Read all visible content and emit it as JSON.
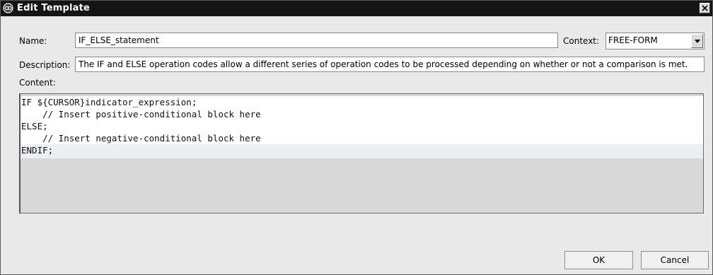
{
  "window": {
    "title": "Edit Template"
  },
  "form": {
    "name_label": "Name:",
    "name_value": "IF_ELSE_statement",
    "context_label": "Context:",
    "context_value": "FREE-FORM",
    "description_label": "Description:",
    "description_value": "The IF and ELSE operation codes allow a different series of operation codes to be processed depending on whether or not a comparison is met.",
    "content_label": "Content:"
  },
  "content": {
    "lines": [
      "IF ${CURSOR}indicator_expression;",
      "    // Insert positive-conditional block here",
      "ELSE;",
      "    // Insert negative-conditional block here",
      "ENDIF;"
    ]
  },
  "buttons": {
    "ok": "OK",
    "cancel": "Cancel"
  },
  "icons": {
    "app": "template-icon",
    "close": "close-icon",
    "dropdown": "chevron-down-icon"
  }
}
